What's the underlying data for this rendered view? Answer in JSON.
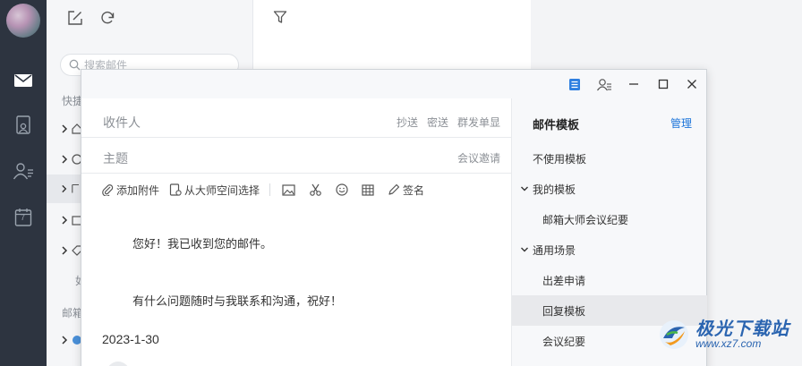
{
  "sidebar": {
    "icons": [
      "mail-icon",
      "contacts-book-icon",
      "contacts-icon",
      "calendar-icon"
    ],
    "calendar_day": "7"
  },
  "maillist": {
    "search_placeholder": "搜索邮件",
    "quick_label": "快捷",
    "mailbox_label": "邮箱",
    "sub_label": "如"
  },
  "compose": {
    "recipients_label": "收件人",
    "cc": "抄送",
    "bcc": "密送",
    "separate_send": "群发单显",
    "subject_label": "主题",
    "meeting_invite": "会议邀请",
    "toolbar": {
      "attach": "添加附件",
      "from_space": "从大师空间选择",
      "signature": "签名"
    },
    "body": {
      "line1": "您好！我已收到您的邮件。",
      "line2": "有什么问题随时与我联系和沟通，祝好！",
      "date": "2023-1-30"
    }
  },
  "templates": {
    "title": "邮件模板",
    "manage": "管理",
    "no_template": "不使用模板",
    "my_templates": "我的模板",
    "my_item1": "邮箱大师会议纪要",
    "common": "通用场景",
    "common_item1": "出差申请",
    "common_item2": "回复模板",
    "common_item3": "会议纪要"
  },
  "watermark": {
    "name": "极光下载站",
    "url": "www.xz7.com"
  },
  "colors": {
    "rail": "#2d3440",
    "accent": "#1a73d9",
    "selected_row": "#e8e9ec"
  }
}
